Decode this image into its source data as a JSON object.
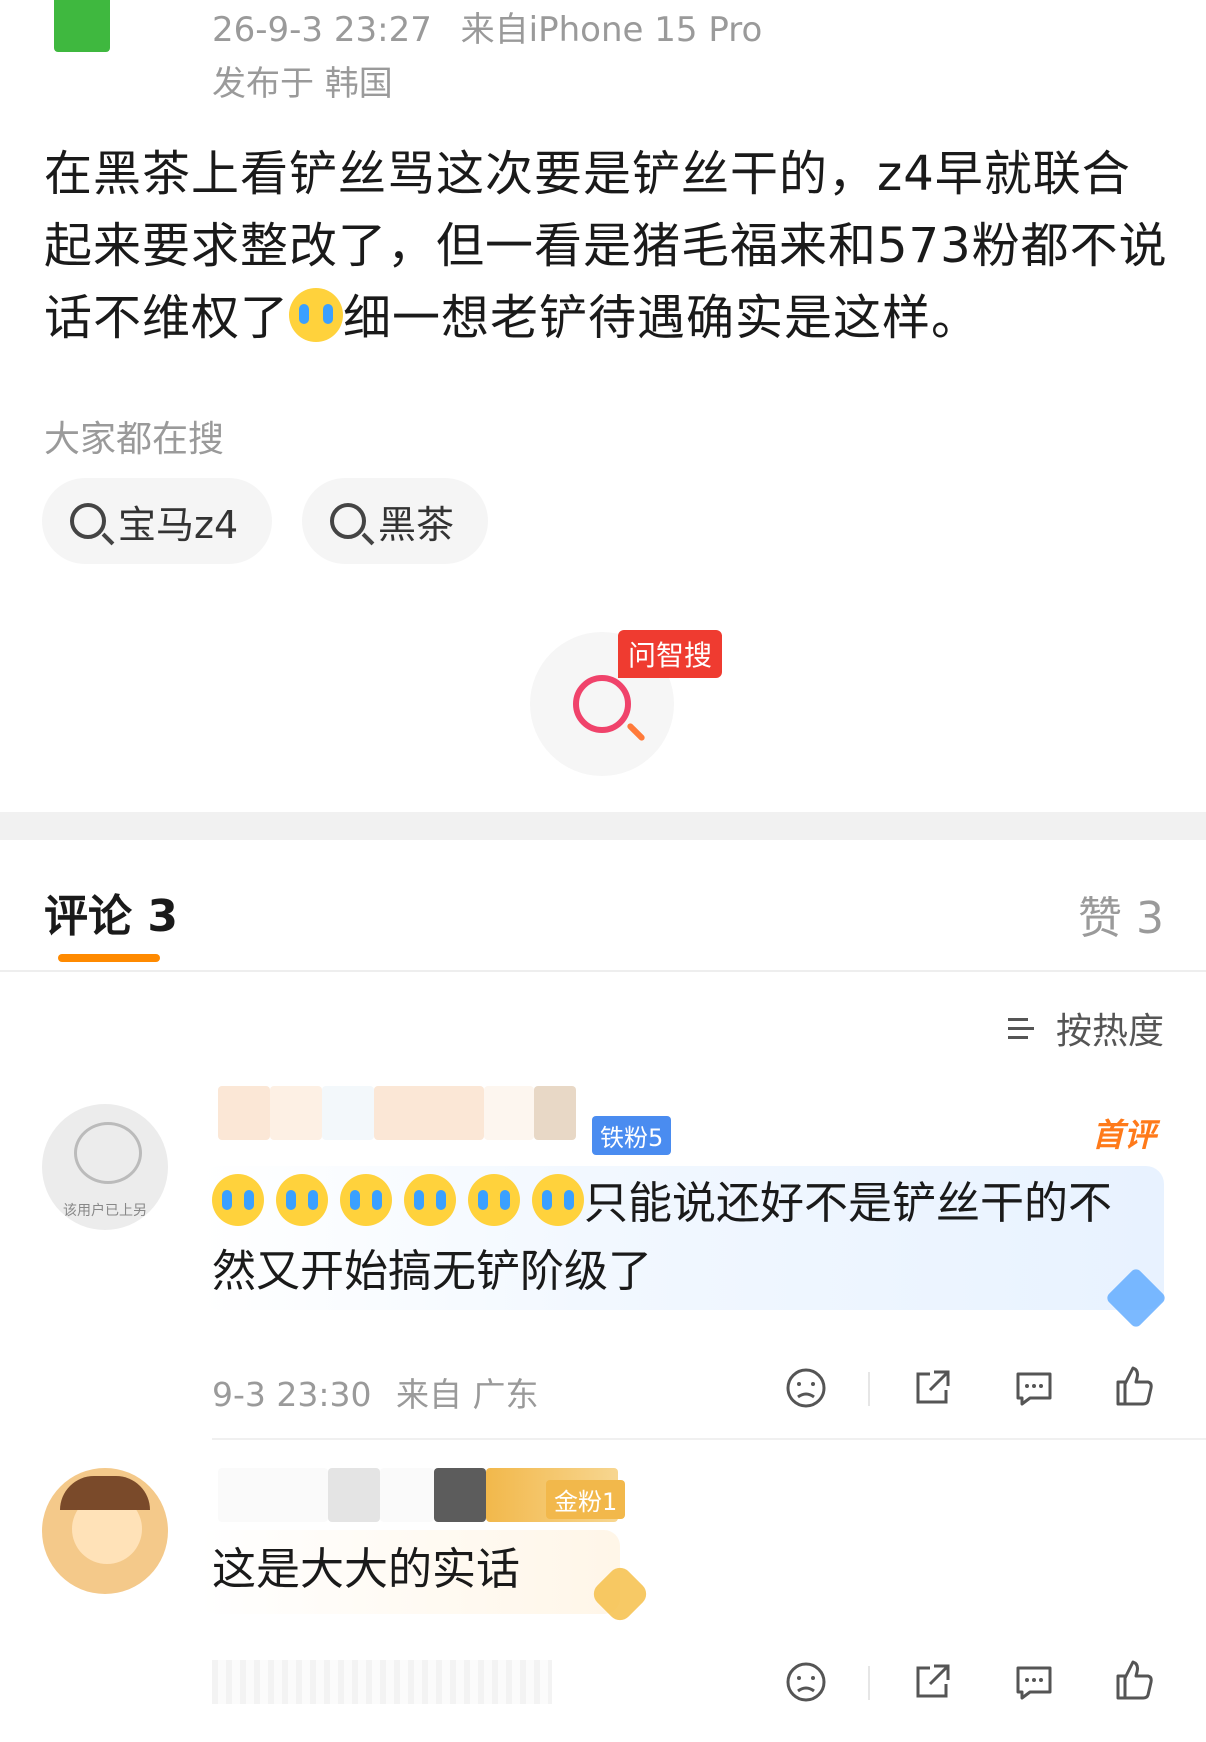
{
  "post": {
    "timestamp": "26-9-3 23:27",
    "device": "来自iPhone 15 Pro",
    "location": "发布于 韩国",
    "text_before_emoji": "在黑茶上看铲丝骂这次要是铲丝干的，z4早就联合起来要求整改了，但一看是猪毛福来和573粉都不说话不维权了",
    "text_after_emoji": "细一想老铲待遇确实是这样。",
    "emoji_name": "crying-face"
  },
  "trending": {
    "title": "大家都在搜",
    "chips": [
      "宝马z4",
      "黑茶"
    ]
  },
  "ai_search": {
    "badge": "问智搜"
  },
  "tabs": {
    "comments": "评论 3",
    "likes": "赞 3"
  },
  "sort": {
    "label": "按热度"
  },
  "comments": [
    {
      "fan_badge": "铁粉5",
      "first_badge": "首评",
      "text": "只能说还好不是铲丝干的不然又开始搞无铲阶级了",
      "emoji_count": 6,
      "avatar_caption": "该用户已上另",
      "time": "9-3 23:30",
      "from": "来自 广东"
    },
    {
      "fan_badge": "金粉1",
      "text": "这是大大的实话"
    }
  ],
  "colors": {
    "accent_orange": "#ff8a00",
    "ai_red": "#ef3b30",
    "meta_gray": "#9a9a9a",
    "iron_fan_blue": "#4a8cf0",
    "gold_fan": "#f2b84b"
  }
}
